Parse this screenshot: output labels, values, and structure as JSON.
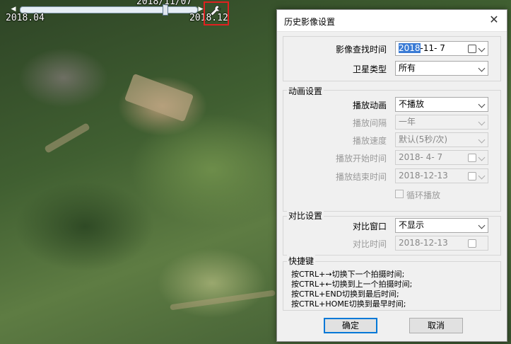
{
  "map": {
    "timeline": {
      "current_date": "2018/11/07",
      "start_label": "2018.04",
      "end_label": "2018.12"
    },
    "tool_icon": "wrench-icon"
  },
  "dialog": {
    "title": "历史影像设置",
    "close_icon": "close-icon",
    "query_time": {
      "label": "影像查找时间",
      "value_year": "2018",
      "value_rest": "-11- 7"
    },
    "satellite_type": {
      "label": "卫星类型",
      "value": "所有"
    },
    "animation": {
      "group_title": "动画设置",
      "play": {
        "label": "播放动画",
        "value": "不播放"
      },
      "interval": {
        "label": "播放间隔",
        "value": "一年"
      },
      "speed": {
        "label": "播放速度",
        "value": "默认(5秒/次)"
      },
      "start_time": {
        "label": "播放开始时间",
        "value": "2018- 4- 7"
      },
      "end_time": {
        "label": "播放结束时间",
        "value": "2018-12-13"
      },
      "loop": {
        "label": "循环播放",
        "checked": false
      }
    },
    "compare": {
      "group_title": "对比设置",
      "window": {
        "label": "对比窗口",
        "value": "不显示"
      },
      "time": {
        "label": "对比时间",
        "value": "2018-12-13"
      }
    },
    "shortcuts": {
      "group_title": "快捷键",
      "lines": [
        "按CTRL+→切换下一个拍摄时间;",
        "按CTRL+←切换到上一个拍摄时间;",
        "按CTRL+END切换到最后时间;",
        "按CTRL+HOME切换到最早时间;"
      ]
    },
    "buttons": {
      "ok": "确定",
      "cancel": "取消"
    }
  }
}
